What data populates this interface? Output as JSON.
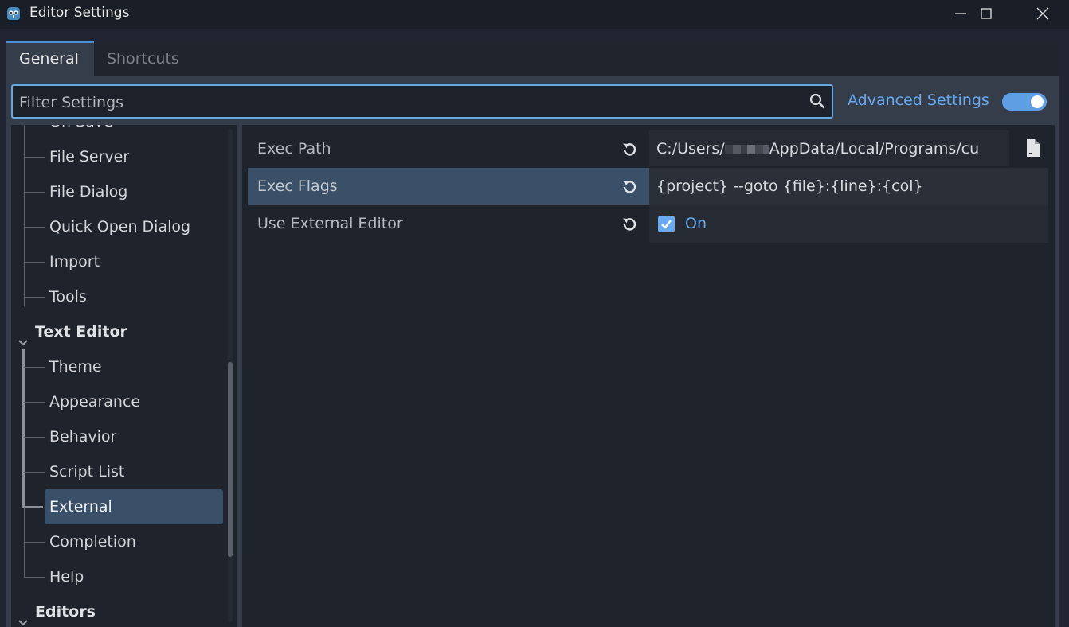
{
  "window": {
    "title": "Editor Settings",
    "accent": "#4c8fd6"
  },
  "tabs": [
    {
      "label": "General",
      "active": true
    },
    {
      "label": "Shortcuts",
      "active": false
    }
  ],
  "filter": {
    "placeholder": "Filter Settings",
    "value": ""
  },
  "advanced_settings": {
    "label": "Advanced Settings",
    "enabled": true
  },
  "tree": {
    "items": [
      {
        "label": "On Save",
        "level": 1
      },
      {
        "label": "File Server",
        "level": 1
      },
      {
        "label": "File Dialog",
        "level": 1
      },
      {
        "label": "Quick Open Dialog",
        "level": 1
      },
      {
        "label": "Import",
        "level": 1
      },
      {
        "label": "Tools",
        "level": 1
      },
      {
        "label": "Text Editor",
        "level": 0,
        "expanded": true
      },
      {
        "label": "Theme",
        "level": 1
      },
      {
        "label": "Appearance",
        "level": 1
      },
      {
        "label": "Behavior",
        "level": 1
      },
      {
        "label": "Script List",
        "level": 1
      },
      {
        "label": "External",
        "level": 1,
        "selected": true
      },
      {
        "label": "Completion",
        "level": 1
      },
      {
        "label": "Help",
        "level": 1
      },
      {
        "label": "Editors",
        "level": 0,
        "expanded": true
      }
    ]
  },
  "properties": [
    {
      "name": "Exec Path",
      "value_prefix": "C:/Users/",
      "value_suffix": "AppData/Local/Programs/cu",
      "type": "file"
    },
    {
      "name": "Exec Flags",
      "value": "{project} --goto {file}:{line}:{col}",
      "type": "text",
      "selected": true
    },
    {
      "name": "Use External Editor",
      "value": "On",
      "type": "bool",
      "checked": true
    }
  ]
}
